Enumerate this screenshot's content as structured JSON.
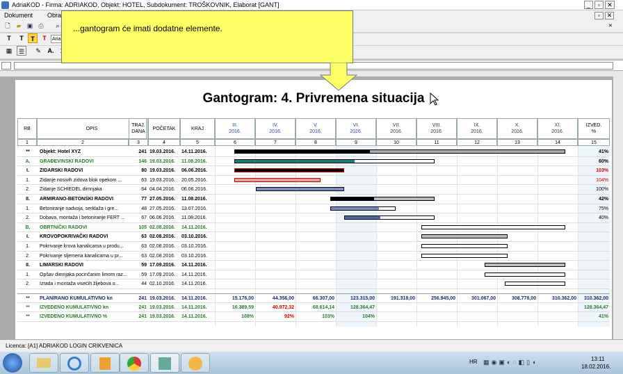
{
  "window": {
    "title": "AdriaKOD - Firma: ADRIAKOD,   Objekt: HOTEL,   Subdokument: TROŠKOVNIK,  Elaborat [GANT]"
  },
  "menu": {
    "items": [
      "Dokument",
      "Obrad"
    ]
  },
  "toolbar": {
    "font_label": "Aria",
    "text_buttons": [
      "T",
      "T",
      "T",
      "T"
    ],
    "mid_label": "A.",
    "mid_num": "1"
  },
  "tooltip": {
    "text": "...gantogram će imati dodatne elemente."
  },
  "gantt": {
    "title": "Gantogram: 4. Privremena situacija",
    "headers": {
      "rb": "RB",
      "opis": "OPIS",
      "traj": "TRAJ.\nDANA",
      "pocetak": "POČETAK",
      "kraj": "KRAJ",
      "izved": "IZVED.\n%"
    },
    "months": [
      [
        "III.",
        "2016."
      ],
      [
        "IV.",
        "2016."
      ],
      [
        "V.",
        "2016."
      ],
      [
        "VI.",
        "2016."
      ],
      [
        "VII.",
        "2016."
      ],
      [
        "VIII.",
        "2016."
      ],
      [
        "IX.",
        "2016."
      ],
      [
        "X.",
        "2016."
      ],
      [
        "XI.",
        "2016."
      ]
    ],
    "colnums": [
      "1",
      "2",
      "3",
      "4",
      "5",
      "6",
      "7",
      "8",
      "9",
      "10",
      "11",
      "12",
      "13",
      "14",
      "15"
    ],
    "rows": [
      {
        "rb": "**",
        "opis": "Objekt: Hotel XYZ",
        "traj": "241",
        "poc": "19.03.2016.",
        "kraj": "14.11.2016.",
        "izv": "41%",
        "style": "bold",
        "bar": [
          0.0,
          0.999
        ],
        "fill": 0.41,
        "color": "#000000",
        "rest": "#aaaaaa"
      },
      {
        "rb": "A.",
        "opis": "GRAĐEVINSKI RADOVI",
        "traj": "146",
        "poc": "19.03.2016.",
        "kraj": "11.08.2016.",
        "izv": "60%",
        "style": "green",
        "bar": [
          0.0,
          0.605
        ],
        "fill": 0.6,
        "color": "#1f7a7a",
        "rest": "#ffffff"
      },
      {
        "rb": "I.",
        "opis": "ZIDARSKI RADOVI",
        "traj": "80",
        "poc": "19.03.2016.",
        "kraj": "06.06.2016.",
        "izv": "103%",
        "style": "bold",
        "bar": [
          0.0,
          0.331
        ],
        "fill": 1.0,
        "color": "#000000",
        "rest": "#ffffff",
        "red": true
      },
      {
        "rb": "1.",
        "opis": "Zidanje nosivih zidova blok opekom ...",
        "traj": "63",
        "poc": "19.03.2016.",
        "kraj": "20.05.2016.",
        "izv": "104%",
        "style": "normal",
        "bar": [
          0.0,
          0.261
        ],
        "fill": 1.0,
        "color": "#e0a0a0",
        "rest": "#ffffff",
        "red": true
      },
      {
        "rb": "2.",
        "opis": "Zidanje SCHIEDEL dimnjaka",
        "traj": "64",
        "poc": "04.04.2016.",
        "kraj": "06.06.2016.",
        "izv": "100%",
        "style": "normal",
        "bar": [
          0.066,
          0.331
        ],
        "fill": 1.0,
        "color": "#7b8cc4",
        "rest": "#ffffff"
      },
      {
        "rb": "II.",
        "opis": "ARMIRANO-BETONSKI RADOVI",
        "traj": "77",
        "poc": "27.05.2016.",
        "kraj": "11.08.2016.",
        "izv": "42%",
        "style": "bold",
        "bar": [
          0.29,
          0.605
        ],
        "fill": 0.42,
        "color": "#000000",
        "rest": "#bbbbbb"
      },
      {
        "rb": "1.",
        "opis": "Betoniranje nadvoja, serklaža i gre...",
        "traj": "48",
        "poc": "27.05.2016.",
        "kraj": "13.07.2016.",
        "izv": "75%",
        "style": "normal",
        "bar": [
          0.29,
          0.488
        ],
        "fill": 0.75,
        "color": "#7b8cc4",
        "rest": "#ffffff"
      },
      {
        "rb": "2.",
        "opis": "Dobava, montaža i betoniranje FERT ...",
        "traj": "67",
        "poc": "06.06.2016.",
        "kraj": "11.08.2016.",
        "izv": "40%",
        "style": "normal",
        "bar": [
          0.331,
          0.605
        ],
        "fill": 0.4,
        "color": "#4a6aa8",
        "rest": "#ffffff"
      },
      {
        "rb": "B.",
        "opis": "OBRTNIČKI RADOVI",
        "traj": "105",
        "poc": "02.08.2016.",
        "kraj": "14.11.2016.",
        "izv": "",
        "style": "green",
        "bar": [
          0.566,
          0.999
        ],
        "fill": 0,
        "color": "#1f7a7a",
        "rest": "#ffffff"
      },
      {
        "rb": "I.",
        "opis": "KROVOPOKRIVAČKI RADOVI",
        "traj": "63",
        "poc": "02.08.2016.",
        "kraj": "03.10.2016.",
        "izv": "",
        "style": "bold",
        "bar": [
          0.566,
          0.826
        ],
        "fill": 0,
        "color": "#000000",
        "rest": "#bbbbbb"
      },
      {
        "rb": "1.",
        "opis": "Pokrivanje krova kanalicama u produ...",
        "traj": "63",
        "poc": "02.08.2016.",
        "kraj": "03.10.2016.",
        "izv": "",
        "style": "normal",
        "bar": [
          0.566,
          0.826
        ],
        "fill": 0,
        "color": "#000000",
        "rest": "#ffffff"
      },
      {
        "rb": "2.",
        "opis": "Pokrivanje sljemena kanalicama u pr...",
        "traj": "63",
        "poc": "02.08.2016.",
        "kraj": "03.10.2016.",
        "izv": "",
        "style": "normal",
        "bar": [
          0.566,
          0.826
        ],
        "fill": 0,
        "color": "#000000",
        "rest": "#ffffff"
      },
      {
        "rb": "II.",
        "opis": "LIMARSKI RADOVI",
        "traj": "59",
        "poc": "17.09.2016.",
        "kraj": "14.11.2016.",
        "izv": "",
        "style": "bold",
        "bar": [
          0.756,
          0.999
        ],
        "fill": 0,
        "color": "#000000",
        "rest": "#bbbbbb"
      },
      {
        "rb": "1.",
        "opis": "Opšav dimnjaka pocinčanim limom raz...",
        "traj": "59",
        "poc": "17.09.2016.",
        "kraj": "14.11.2016.",
        "izv": "",
        "style": "normal",
        "bar": [
          0.756,
          0.999
        ],
        "fill": 0,
        "color": "#000000",
        "rest": "#ffffff"
      },
      {
        "rb": "2.",
        "opis": "Izrada i montaža visećih žljebova o...",
        "traj": "44",
        "poc": "02.10.2016.",
        "kraj": "14.11.2016.",
        "izv": "",
        "style": "normal",
        "bar": [
          0.818,
          0.999
        ],
        "fill": 0,
        "color": "#000000",
        "rest": "#ffffff"
      }
    ],
    "summary": [
      {
        "rb": "**",
        "opis": "PLANIRANO KUMULATIVNO kn",
        "traj": "241",
        "poc": "19.03.2016.",
        "kraj": "14.11.2016.",
        "vals": [
          "15.176,00",
          "44.356,00",
          "66.307,00",
          "123.315,00",
          "191.318,00",
          "256.945,00",
          "301.067,00",
          "308.778,00",
          "310.362,00"
        ],
        "izv": "310.362,00",
        "cls": "navy"
      },
      {
        "rb": "**",
        "opis": "IZVEDENO KUMULATIVNO kn",
        "traj": "241",
        "poc": "19.03.2016.",
        "kraj": "14.11.2016.",
        "vals": [
          "16.389,59",
          "40.972,32",
          "68.614,14",
          "128.364,47",
          "",
          "",
          "",
          "",
          ""
        ],
        "izv": "128.364,47",
        "cls": "green",
        "redidx": [
          1
        ]
      },
      {
        "rb": "**",
        "opis": "IZVEDENO KUMULATIVNO %",
        "traj": "241",
        "poc": "19.03.2016.",
        "kraj": "14.11.2016.",
        "vals": [
          "108%",
          "92%",
          "103%",
          "104%",
          "",
          "",
          "",
          "",
          ""
        ],
        "izv": "41%",
        "cls": "green",
        "redidx": [
          1
        ]
      }
    ]
  },
  "status": {
    "licence": "Licenca:  [A1] ADRIAKOD LOGIN CRIKVENICA"
  },
  "taskbar": {
    "lang": "HR",
    "time": "13:11",
    "date": "18.02.2016."
  }
}
